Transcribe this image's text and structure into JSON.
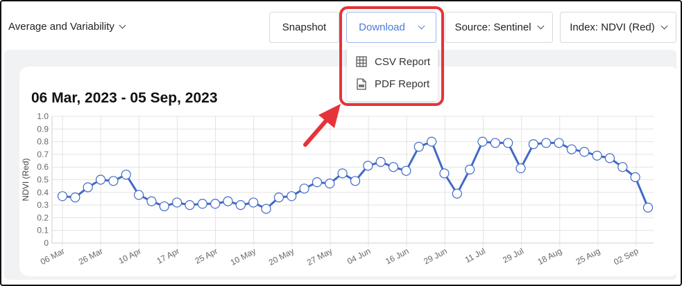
{
  "toolbar": {
    "aggregation_label": "Average and Variability",
    "snapshot_label": "Snapshot",
    "download_label": "Download",
    "source_label": "Source: Sentinel",
    "index_label": "Index: NDVI (Red)"
  },
  "download_menu": {
    "items": [
      {
        "label": "CSV Report",
        "icon": "table-icon"
      },
      {
        "label": "PDF Report",
        "icon": "pdf-file-icon"
      }
    ]
  },
  "colors": {
    "accent": "#4a7bd6",
    "series_line": "#4169c7",
    "highlight": "#e8323a",
    "panel_bg": "#f1f2f4"
  },
  "chart_data": {
    "type": "line",
    "title": "06 Mar, 2023 - 05 Sep, 2023",
    "ylabel": "NDVI (Red)",
    "xlabel": "",
    "ylim": [
      0,
      1.0
    ],
    "yticks": [
      "0",
      "0.1",
      "0.2",
      "0.3",
      "0.4",
      "0.5",
      "0.6",
      "0.7",
      "0.8",
      "0.9",
      "1.0"
    ],
    "xtick_labels": [
      "06 Mar",
      "26 Mar",
      "10 Apr",
      "17 Apr",
      "25 Apr",
      "10 May",
      "20 May",
      "27 May",
      "04 Jun",
      "16 Jun",
      "29 Jun",
      "11 Jul",
      "29 Jul",
      "18 Aug",
      "25 Aug",
      "02 Sep"
    ],
    "grid": true,
    "series": [
      {
        "values": [
          0.37,
          0.36,
          0.44,
          0.5,
          0.49,
          0.54,
          0.38,
          0.33,
          0.29,
          0.32,
          0.3,
          0.31,
          0.31,
          0.33,
          0.3,
          0.32,
          0.27,
          0.36,
          0.37,
          0.43,
          0.48,
          0.47,
          0.55,
          0.49,
          0.61,
          0.64,
          0.6,
          0.57,
          0.76,
          0.8,
          0.55,
          0.39,
          0.58,
          0.8,
          0.79,
          0.79,
          0.59,
          0.78,
          0.79,
          0.79,
          0.74,
          0.72,
          0.69,
          0.67,
          0.6,
          0.52,
          0.28
        ]
      }
    ]
  }
}
